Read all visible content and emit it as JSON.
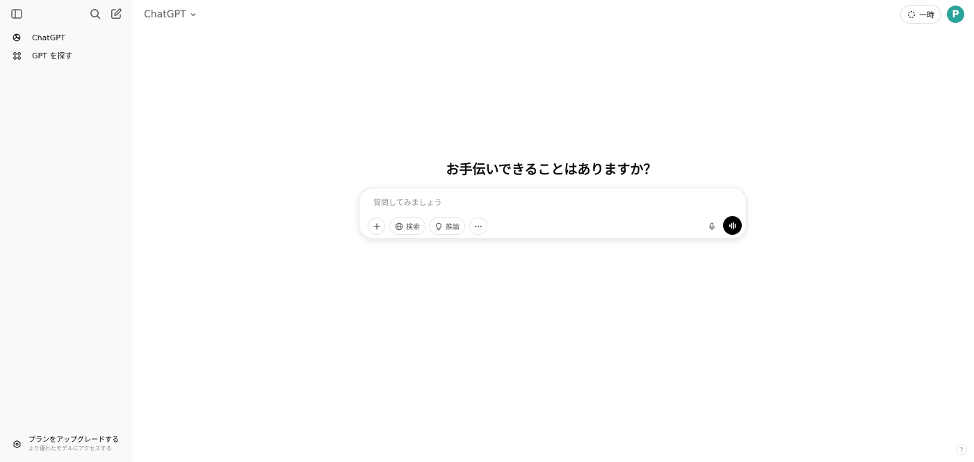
{
  "sidebar": {
    "items": [
      {
        "label": "ChatGPT",
        "icon": "openai-logo-icon"
      },
      {
        "label": "GPT を探す",
        "icon": "grid-icon"
      }
    ],
    "upgrade": {
      "title": "プランをアップグレードする",
      "subtitle": "より優れたモデルにアクセスする",
      "icon": "upgrade-icon"
    }
  },
  "header": {
    "model_name": "ChatGPT",
    "temporary_label": "一時",
    "avatar_letter": "P",
    "avatar_color": "#2aa39a"
  },
  "main": {
    "headline": "お手伝いできることはありますか？",
    "composer": {
      "placeholder": "質問してみましょう",
      "search_label": "検索",
      "reason_label": "推論"
    }
  },
  "help_label": "?"
}
